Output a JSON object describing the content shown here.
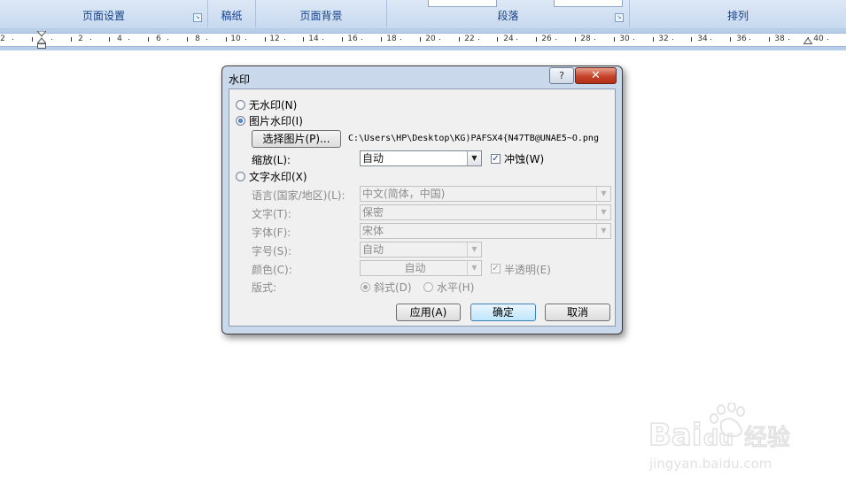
{
  "ribbon": {
    "groups": [
      "页面设置",
      "稿纸",
      "页面背景",
      "段落",
      "排列"
    ]
  },
  "ruler": {
    "numbers": [
      "2",
      "2",
      "4",
      "6",
      "8",
      "10",
      "12",
      "14",
      "16",
      "18",
      "20",
      "22",
      "24",
      "26",
      "28",
      "30",
      "32",
      "34",
      "36",
      "38",
      "40"
    ]
  },
  "dialog": {
    "title": "水印",
    "help_label": "?",
    "close_label": "✕",
    "no_watermark": "无水印(N)",
    "picture_watermark": "图片水印(I)",
    "select_picture_button": "选择图片(P)...",
    "picture_path": "C:\\Users\\HP\\Desktop\\KG)PAFSX4{N47TB@UNAE5~O.png",
    "scale_label": "缩放(L):",
    "scale_value": "自动",
    "washout_label": "冲蚀(W)",
    "text_watermark": "文字水印(X)",
    "language_label": "语言(国家/地区)(L):",
    "language_value": "中文(简体，中国)",
    "text_label": "文字(T):",
    "text_value": "保密",
    "font_label": "字体(F):",
    "font_value": "宋体",
    "size_label": "字号(S):",
    "size_value": "自动",
    "color_label": "颜色(C):",
    "color_value": "自动",
    "semitransparent_label": "半透明(E)",
    "layout_label": "版式:",
    "diagonal_label": "斜式(D)",
    "horizontal_label": "水平(H)",
    "apply_button": "应用(A)",
    "ok_button": "确定",
    "cancel_button": "取消"
  },
  "watermark_logo": {
    "brand": "Baidu经验",
    "url": "jingyan.baidu.com"
  }
}
